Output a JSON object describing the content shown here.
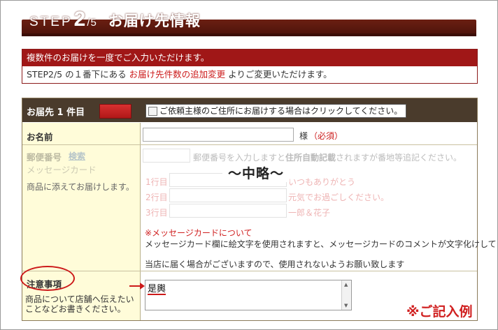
{
  "header": {
    "step_word": "STEP",
    "step_current": "2",
    "step_total": "/5",
    "title": "お届け先情報"
  },
  "notice": {
    "top_text": "複数件のお届けを一度でご入力いただけます。",
    "line_prefix": "STEP2/5 の１番下にある ",
    "line_link": "お届け先件数の追加変更",
    "line_suffix": " よりご変更いただけます。"
  },
  "form": {
    "head_label": "お届先 1  件目",
    "copy_checkbox_label": "ご依頼主様のご住所にお届けする場合はクリックしてください。",
    "name_label": "お名前",
    "name_suffix": "様",
    "required_text": "（必須）",
    "postal_label": "郵便番号",
    "postal_search": "検索",
    "postal_hint_1": "郵便番号を入力しますと",
    "postal_hint_bold": "住所自動記載",
    "postal_hint_2": "されますが番地等追記ください。",
    "message_label_faded": "メッセージカード",
    "message_note": "商品に添えてお届けします。",
    "lines": [
      "1行目",
      "2行目",
      "3行目"
    ],
    "line_examples": [
      "いつもありがとう",
      "元気でお過ごしください。",
      "一郎＆花子"
    ],
    "omitted": "～中略～",
    "card_about": "※メッセージカードについて",
    "card_desc_1": "メッセージカード欄に絵文字を使用されますと、メッセージカードのコメントが文字化けして",
    "card_desc_2": "当店に届く場合がございますので、使用されないようお願い致します",
    "notes_label": "注意事項",
    "notes_desc": "商品について店舗へ伝えたいことなどお書きください。",
    "notes_value": "是輿"
  },
  "example_label": "※ご記入例",
  "colors": {
    "header_bg": "#5c180d",
    "notice_red": "#a01717",
    "form_head_bg": "#4a3b2c",
    "label_bg": "#fffcd9",
    "accent_red": "#cc1a1a"
  }
}
